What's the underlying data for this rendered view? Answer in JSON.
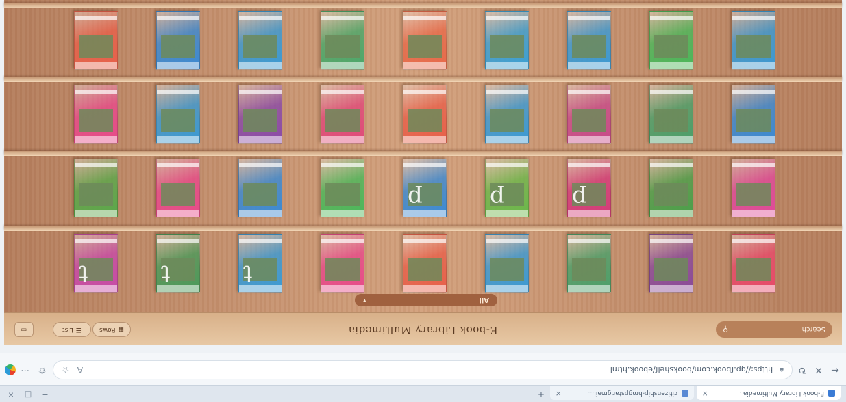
{
  "browser": {
    "tabs": [
      {
        "label": "E-book Library Multimedia …",
        "active": true
      },
      {
        "label": "citizenship-hmgpstar.gmail…",
        "active": false
      }
    ],
    "url": "https://gp.fbook.com/bookshelf/ebook.html",
    "window_buttons": [
      "−",
      "□",
      "×"
    ]
  },
  "header": {
    "search_label": "Search",
    "title": "E-book Library Multimedia",
    "buttons": [
      {
        "label": "Rows",
        "icon": "grid-icon"
      },
      {
        "label": "List",
        "icon": "list-icon"
      }
    ]
  },
  "filter": {
    "label": "All",
    "arrow": "▾"
  },
  "colors": {
    "shelf_wood": "#c48e6a",
    "header_wood": "#e0bd97",
    "search_bg": "#b8815a",
    "filter_bg": "#a0613f"
  },
  "shelves": [
    {
      "books": [
        {
          "color": "#e84a6a",
          "letter": ""
        },
        {
          "color": "#8a4a9a",
          "letter": ""
        },
        {
          "color": "#4aa06a",
          "letter": ""
        },
        {
          "color": "#3a9ad4",
          "letter": ""
        },
        {
          "color": "#e8604a",
          "letter": ""
        },
        {
          "color": "#e84a8a",
          "letter": ""
        },
        {
          "color": "#3a9ad4",
          "letter": "t"
        },
        {
          "color": "#4a9a5a",
          "letter": "t"
        },
        {
          "color": "#c84aa8",
          "letter": "t"
        }
      ]
    },
    {
      "books": [
        {
          "color": "#e04a9a",
          "letter": ""
        },
        {
          "color": "#4aa04a",
          "letter": ""
        },
        {
          "color": "#d43a7a",
          "letter": "p"
        },
        {
          "color": "#6ab84a",
          "letter": "p"
        },
        {
          "color": "#3a8ad4",
          "letter": "p"
        },
        {
          "color": "#4ab85a",
          "letter": ""
        },
        {
          "color": "#3a8ad4",
          "letter": ""
        },
        {
          "color": "#e84a8a",
          "letter": ""
        },
        {
          "color": "#5aa84a",
          "letter": ""
        }
      ]
    },
    {
      "books": [
        {
          "color": "#3a8ad4",
          "letter": ""
        },
        {
          "color": "#4aa06a",
          "letter": ""
        },
        {
          "color": "#c84a8a",
          "letter": ""
        },
        {
          "color": "#3a9ad4",
          "letter": ""
        },
        {
          "color": "#e8604a",
          "letter": ""
        },
        {
          "color": "#e04a7a",
          "letter": ""
        },
        {
          "color": "#8a4aa8",
          "letter": ""
        },
        {
          "color": "#3a9ad4",
          "letter": ""
        },
        {
          "color": "#e84a8a",
          "letter": ""
        }
      ]
    },
    {
      "books": [
        {
          "color": "#3a9ad4",
          "letter": ""
        },
        {
          "color": "#4ab85a",
          "letter": ""
        },
        {
          "color": "#3a9ad4",
          "letter": ""
        },
        {
          "color": "#3aa0d4",
          "letter": ""
        },
        {
          "color": "#e86a4a",
          "letter": ""
        },
        {
          "color": "#4aa86a",
          "letter": ""
        },
        {
          "color": "#3a9ad4",
          "letter": ""
        },
        {
          "color": "#3a8ad4",
          "letter": ""
        },
        {
          "color": "#e8604a",
          "letter": ""
        }
      ]
    }
  ]
}
